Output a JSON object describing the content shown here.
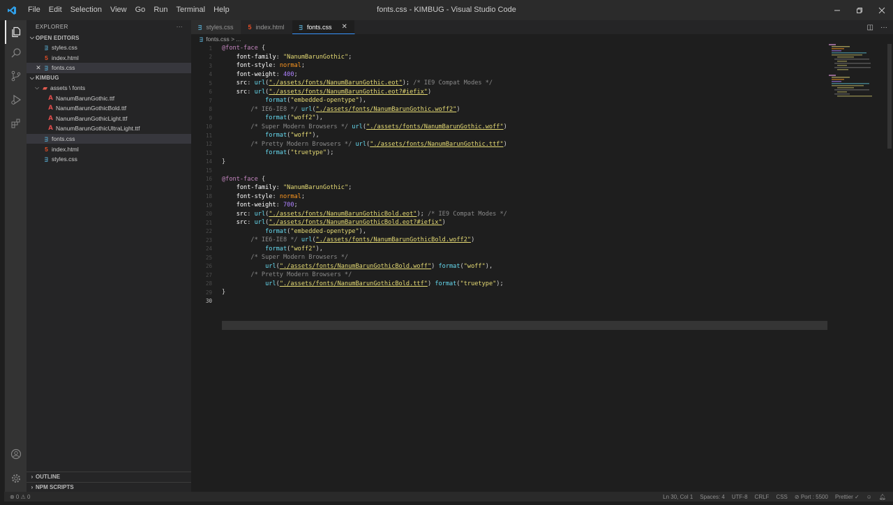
{
  "window": {
    "title": "fonts.css - KIMBUG - Visual Studio Code"
  },
  "menu": [
    "File",
    "Edit",
    "Selection",
    "View",
    "Go",
    "Run",
    "Terminal",
    "Help"
  ],
  "sidebar": {
    "header": "EXPLORER",
    "more": "···",
    "open_editors_title": "OPEN EDITORS",
    "open_editors": [
      {
        "name": "styles.css",
        "type": "css"
      },
      {
        "name": "index.html",
        "type": "html"
      },
      {
        "name": "fonts.css",
        "type": "css",
        "active": true
      }
    ],
    "workspace_title": "KIMBUG",
    "tree": {
      "folder": "assets \\ fonts",
      "fonts": [
        "NanumBarunGothic.ttf",
        "NanumBarunGothicBold.ttf",
        "NanumBarunGothicLight.ttf",
        "NanumBarunGothicUltraLight.ttf"
      ],
      "files": [
        {
          "name": "fonts.css",
          "type": "css"
        },
        {
          "name": "index.html",
          "type": "html"
        },
        {
          "name": "styles.css",
          "type": "css"
        }
      ]
    },
    "outline": "OUTLINE",
    "npm": "NPM SCRIPTS"
  },
  "tabs": [
    {
      "name": "styles.css",
      "type": "css"
    },
    {
      "name": "index.html",
      "type": "html"
    },
    {
      "name": "fonts.css",
      "type": "css",
      "active": true
    }
  ],
  "breadcrumb": "fonts.css > ...",
  "code": {
    "line_numbers": [
      "1",
      "2",
      "3",
      "4",
      "5",
      "6",
      "7",
      "8",
      "9",
      "10",
      "11",
      "12",
      "13",
      "14",
      "15",
      "16",
      "17",
      "18",
      "19",
      "20",
      "21",
      "22",
      "23",
      "24",
      "25",
      "26",
      "27",
      "28",
      "29",
      "30"
    ],
    "ff": "font-family",
    "fs": "font-style",
    "fw": "font-weight",
    "src": "src",
    "at_rule": "@font-face",
    "family_val": "\"NanumBarunGothic\"",
    "style_val": "normal",
    "w400": "400",
    "w700": "700",
    "url": "url",
    "format": "format",
    "b1_eot": "\"./assets/fonts/NanumBarunGothic.eot\"",
    "b1_eot_fix": "\"./assets/fonts/NanumBarunGothic.eot?#iefix\"",
    "b1_woff2": "\"./assets/fonts/NanumBarunGothic.woff2\"",
    "b1_woff": "\"./assets/fonts/NanumBarunGothic.woff\"",
    "b1_ttf": "\"./assets/fonts/NanumBarunGothic.ttf\"",
    "b2_eot": "\"./assets/fonts/NanumBarunGothicBold.eot\"",
    "b2_eot_fix": "\"./assets/fonts/NanumBarunGothicBold.eot?#iefix\"",
    "b2_woff2": "\"./assets/fonts/NanumBarunGothicBold.woff2\"",
    "b2_woff": "\"./assets/fonts/NanumBarunGothicBold.woff\"",
    "b2_ttf": "\"./assets/fonts/NanumBarunGothicBold.ttf\"",
    "fmt_eot": "\"embedded-opentype\"",
    "fmt_woff2": "\"woff2\"",
    "fmt_woff": "\"woff\"",
    "fmt_ttf": "\"truetype\"",
    "c_ie9": "/* IE9 Compat Modes */",
    "c_ie6": "/* IE6-IE8 */",
    "c_super": "/* Super Modern Browsers */",
    "c_pretty": "/* Pretty Modern Browsers */"
  },
  "status": {
    "problems": "⊗ 0 ⚠ 0",
    "position": "Ln 30, Col 1",
    "spaces": "Spaces: 4",
    "encoding": "UTF-8",
    "eol": "CRLF",
    "language": "CSS",
    "port": "⊘ Port : 5500",
    "prettier": "Prettier ✓"
  },
  "colors": {
    "accent": "#3794ff",
    "activity": "#333333",
    "sidebar": "#252526",
    "editor": "#1e1e1e"
  }
}
